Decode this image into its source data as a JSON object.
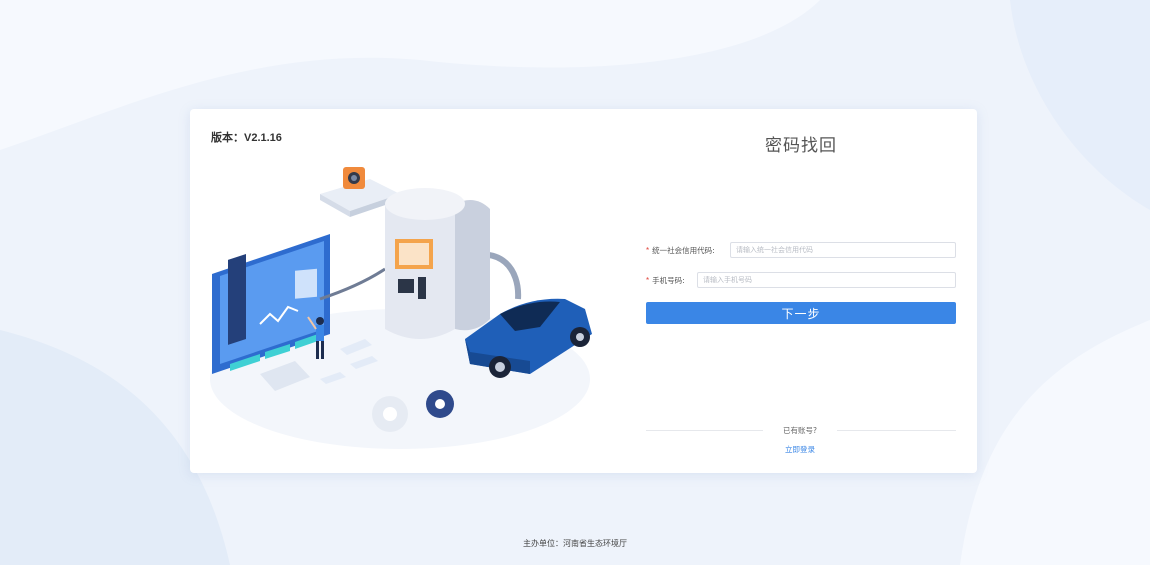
{
  "version": "版本：V2.1.16",
  "form": {
    "title": "密码找回",
    "credit_code": {
      "required_mark": "*",
      "label": "统一社会信用代码:",
      "placeholder": "请输入统一社会信用代码"
    },
    "phone": {
      "required_mark": "*",
      "label": "手机号码:",
      "placeholder": "请输入手机号码"
    },
    "next_button": "下一步",
    "has_account": "已有账号?",
    "login_link": "立即登录"
  },
  "footer": "主办单位：河南省生态环境厅",
  "colors": {
    "accent": "#3a86e6",
    "required": "#e0443b",
    "page_bg": "#eaf1fb"
  }
}
